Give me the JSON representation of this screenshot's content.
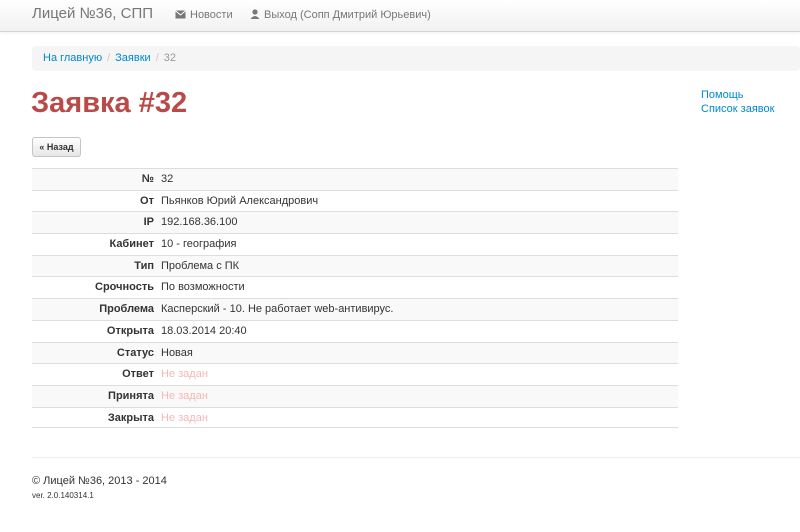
{
  "navbar": {
    "brand": "Лицей №36, СПП",
    "news": {
      "label": "Новости",
      "icon": "envelope-icon"
    },
    "logout": {
      "label": "Выход (Сопп Дмитрий Юрьевич)",
      "icon": "user-icon"
    }
  },
  "breadcrumb": {
    "home": "На главную",
    "requests": "Заявки",
    "separator": "/",
    "current": "32"
  },
  "page": {
    "title": "Заявка #32",
    "back_button": "« Назад"
  },
  "sidebar": {
    "help": "Помощь",
    "requests_list": "Список заявок"
  },
  "details": [
    {
      "label": "№",
      "value": "32",
      "muted": false
    },
    {
      "label": "От",
      "value": "Пьянков Юрий Александрович",
      "muted": false
    },
    {
      "label": "IP",
      "value": "192.168.36.100",
      "muted": false
    },
    {
      "label": "Кабинет",
      "value": "10 - география",
      "muted": false
    },
    {
      "label": "Тип",
      "value": "Проблема с ПК",
      "muted": false
    },
    {
      "label": "Срочность",
      "value": "По возможности",
      "muted": false
    },
    {
      "label": "Проблема",
      "value": "Касперский - 10. Не работает web-антивирус.",
      "muted": false
    },
    {
      "label": "Открыта",
      "value": "18.03.2014 20:40",
      "muted": false
    },
    {
      "label": "Статус",
      "value": "Новая",
      "muted": false
    },
    {
      "label": "Ответ",
      "value": "Не задан",
      "muted": true
    },
    {
      "label": "Принята",
      "value": "Не задан",
      "muted": true
    },
    {
      "label": "Закрыта",
      "value": "Не задан",
      "muted": true
    }
  ],
  "footer": {
    "copyright": "© Лицей №36, 2013 - 2014",
    "version": "ver. 2.0.140314.1"
  },
  "colors": {
    "title": "#b94a48",
    "link": "#0088cc",
    "muted_value": "#f2b8b8"
  }
}
